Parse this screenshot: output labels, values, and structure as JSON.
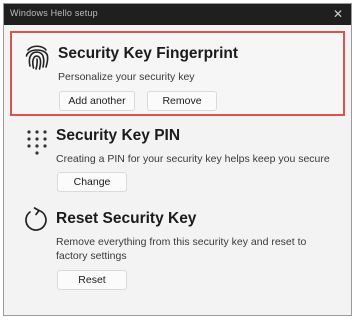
{
  "window": {
    "title": "Windows Hello setup",
    "close_symbol": "✕"
  },
  "sections": {
    "fingerprint": {
      "icon": "fingerprint-icon",
      "title": "Security Key Fingerprint",
      "description": "Personalize your security key",
      "buttons": {
        "add": "Add another",
        "remove": "Remove"
      }
    },
    "pin": {
      "icon": "keypad-dots-icon",
      "title": "Security Key PIN",
      "description": "Creating a PIN for your security key helps keep you secure",
      "buttons": {
        "change": "Change"
      }
    },
    "reset": {
      "icon": "reset-arrow-icon",
      "title": "Reset Security Key",
      "description": "Remove everything from this security key and reset to factory settings",
      "buttons": {
        "reset": "Reset"
      }
    }
  },
  "colors": {
    "selection_border": "#d9534f",
    "titlebar": "#1f1f1f"
  }
}
